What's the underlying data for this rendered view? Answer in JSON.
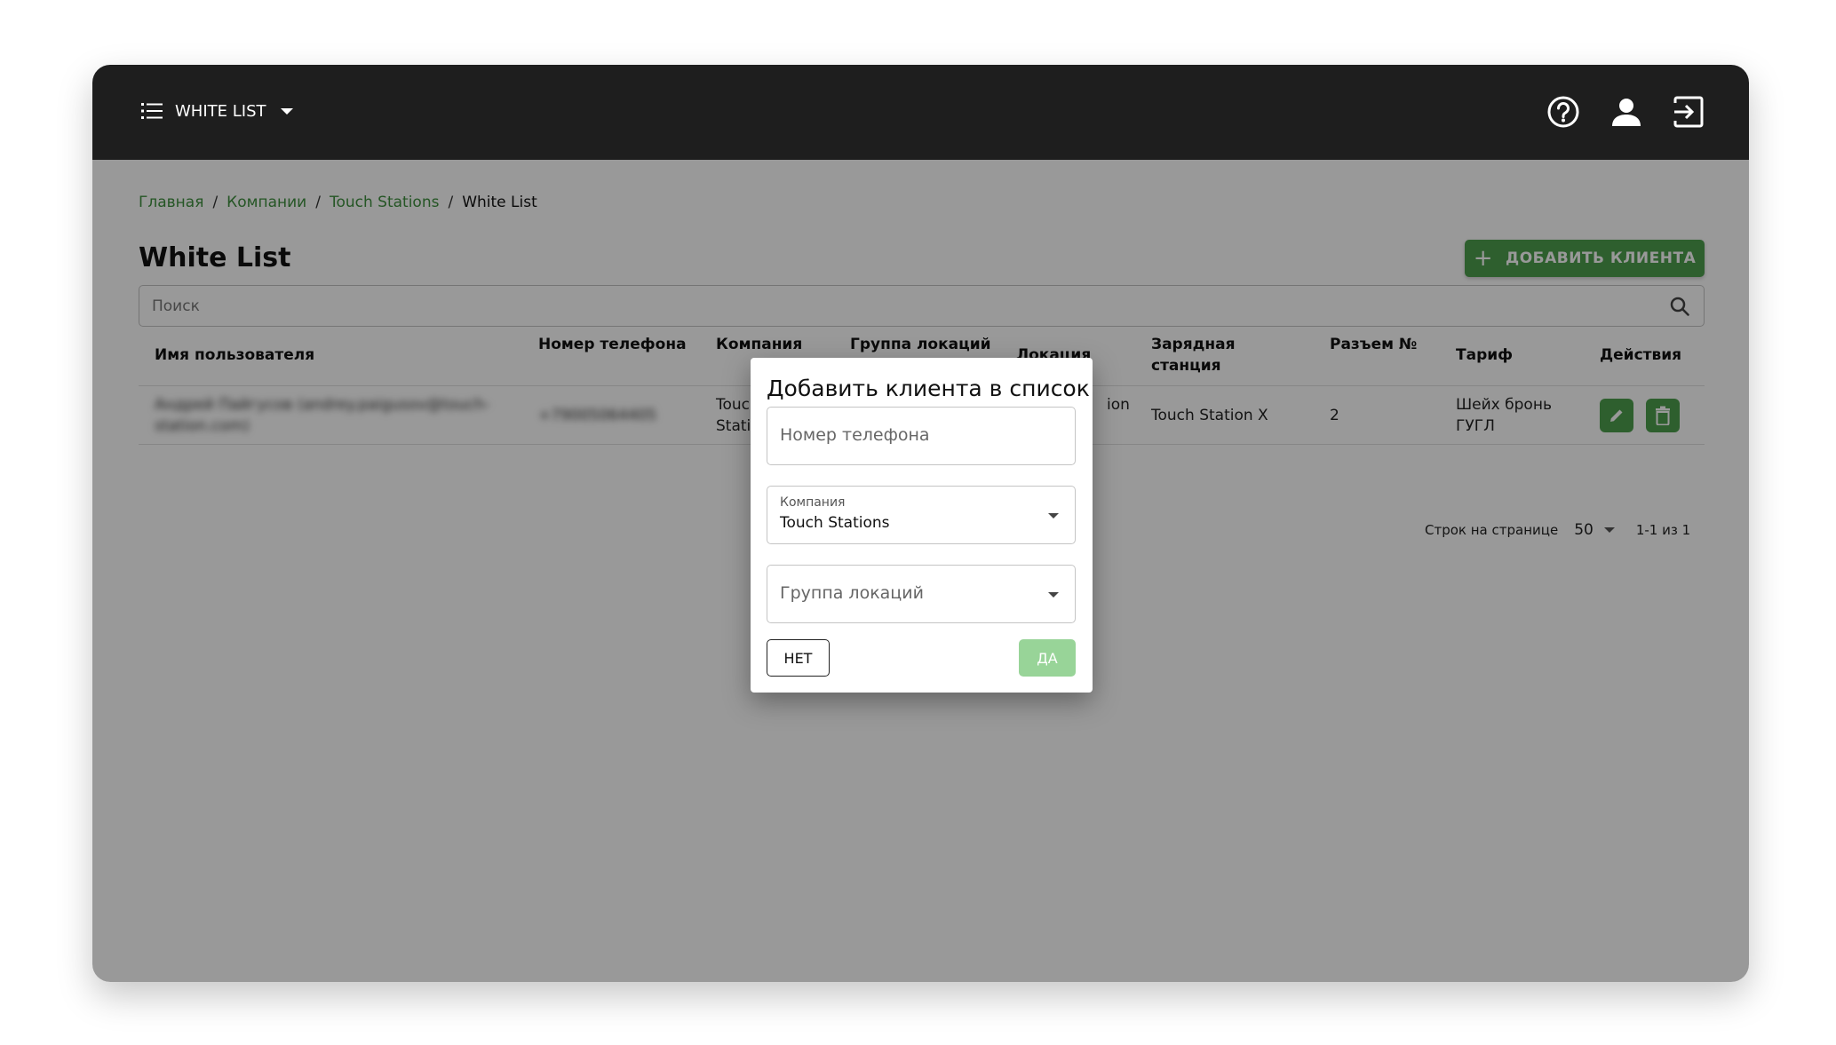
{
  "app": {
    "section_selector": "WHITE LIST",
    "icons": [
      "menu-icon",
      "help-icon",
      "user-icon",
      "logout-icon"
    ]
  },
  "breadcrumb": {
    "items": [
      "Главная",
      "Компании",
      "Touch Stations",
      "White List"
    ],
    "separator": "/"
  },
  "page": {
    "title": "White List",
    "add_button": "ДОБАВИТЬ КЛИЕНТА"
  },
  "search": {
    "placeholder": "Поиск"
  },
  "table": {
    "headers": {
      "user": "Имя пользователя",
      "phone": "Номер телефона",
      "company": "Компания",
      "location_group": "Группа локаций",
      "location": "Локация",
      "station_l1": "Зарядная",
      "station_l2": "станция",
      "connector": "Разъем №",
      "tariff": "Тариф",
      "actions": "Действия"
    },
    "rows": [
      {
        "user_l1": "Андрей Пайгусов (andrey.paigusov@touch-",
        "user_l2": "station.com)",
        "phone": "+79005064405",
        "company_l1": "Touch",
        "company_l2": "Statio",
        "location_tail": "ion",
        "station": "Touch Station X",
        "connector": "2",
        "tariff_l1": "Шейх бронь",
        "tariff_l2": "ГУГЛ"
      }
    ]
  },
  "pagination": {
    "rows_label": "Строк на странице",
    "rows_value": "50",
    "range": "1-1 из 1"
  },
  "dialog": {
    "title": "Добавить клиента в список",
    "phone_placeholder": "Номер телефона",
    "company_label": "Компания",
    "company_value": "Touch Stations",
    "location_group_placeholder": "Группа локаций",
    "cancel": "НЕТ",
    "confirm": "ДА"
  },
  "colors": {
    "topbar": "#1e1e1e",
    "accent_green": "#4e9e4e",
    "link_green": "#3f8f3f",
    "confirm_disabled": "#98d498"
  }
}
